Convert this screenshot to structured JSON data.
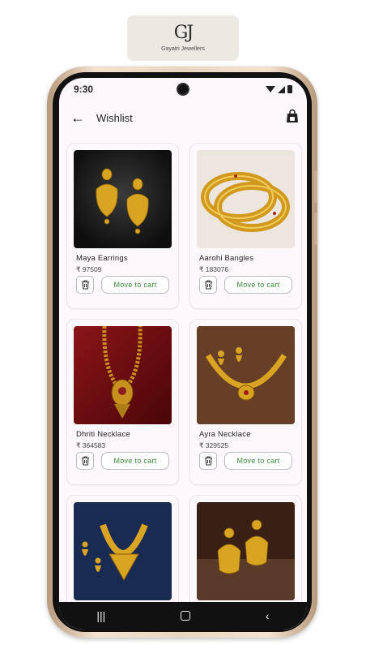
{
  "brand": {
    "mark": "GJ",
    "name": "Gayatri Jewellers"
  },
  "status_bar": {
    "time": "9:30"
  },
  "app_bar": {
    "title": "Wishlist",
    "back_icon": "arrow-left-icon",
    "bag_icon": "shopping-bag-icon"
  },
  "wishlist": {
    "move_label": "Move to cart",
    "items": [
      {
        "name": "Maya Earrings",
        "price": "₹ 97509"
      },
      {
        "name": "Aarohi Bangles",
        "price": "₹ 183076"
      },
      {
        "name": "Dhriti Necklace",
        "price": "₹ 364583"
      },
      {
        "name": "Ayra Necklace",
        "price": "₹ 329525"
      },
      {
        "name": "",
        "price": ""
      },
      {
        "name": "",
        "price": ""
      }
    ]
  },
  "colors": {
    "accent_green": "#3a8a3a",
    "gold": "#d4a020",
    "background": "#fdf8fc"
  }
}
